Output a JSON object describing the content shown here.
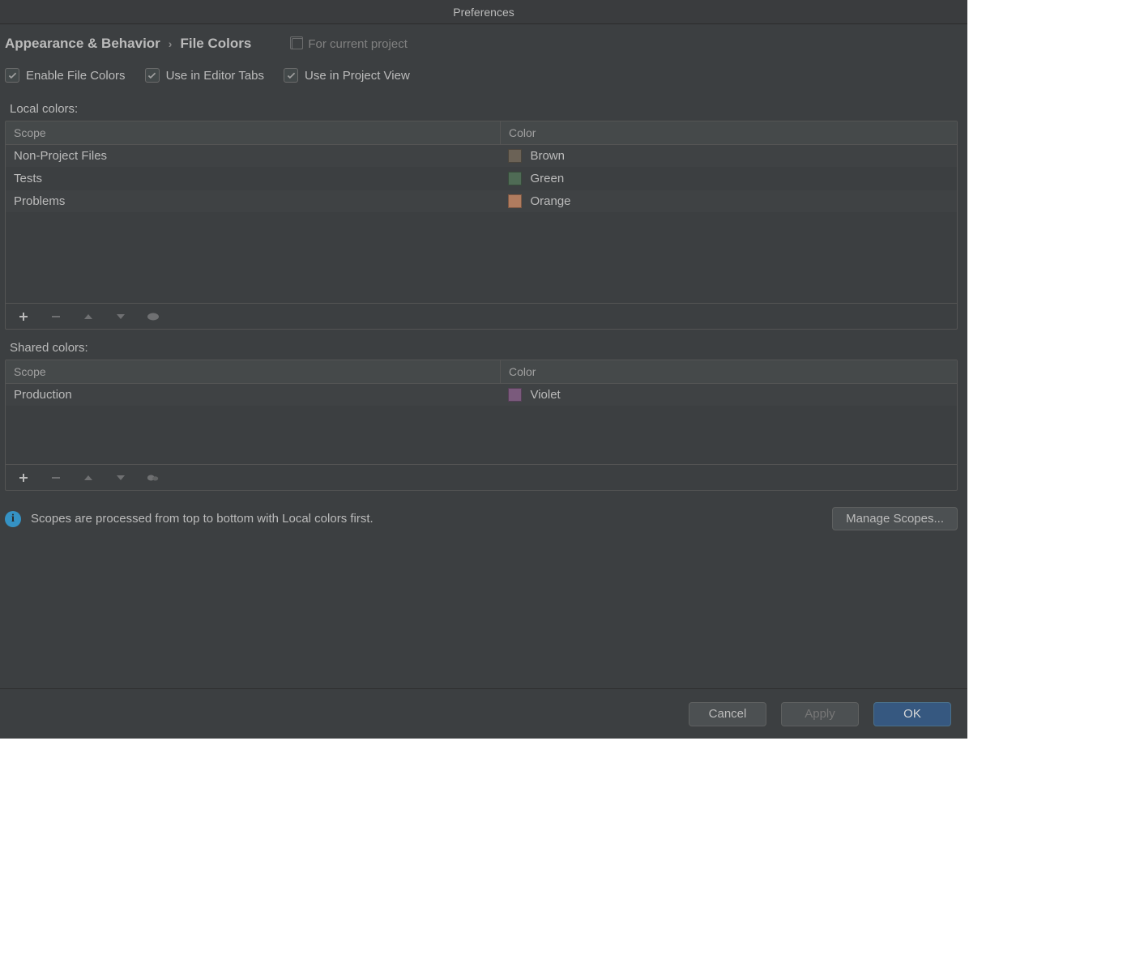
{
  "window": {
    "title": "Preferences"
  },
  "breadcrumb": {
    "parent": "Appearance & Behavior",
    "current": "File Colors"
  },
  "scope_indicator": "For current project",
  "checkboxes": {
    "enable": "Enable File Colors",
    "editor_tabs": "Use in Editor Tabs",
    "project_view": "Use in Project View"
  },
  "sections": {
    "local": {
      "label": "Local colors:",
      "columns": {
        "scope": "Scope",
        "color": "Color"
      },
      "rows": [
        {
          "scope": "Non-Project Files",
          "color_name": "Brown",
          "swatch": "#6b6256"
        },
        {
          "scope": "Tests",
          "color_name": "Green",
          "swatch": "#4f6b55"
        },
        {
          "scope": "Problems",
          "color_name": "Orange",
          "swatch": "#b07c5f"
        }
      ]
    },
    "shared": {
      "label": "Shared colors:",
      "columns": {
        "scope": "Scope",
        "color": "Color"
      },
      "rows": [
        {
          "scope": "Production",
          "color_name": "Violet",
          "swatch": "#7a5a7c"
        }
      ]
    }
  },
  "info": "Scopes are processed from top to bottom with Local colors first.",
  "buttons": {
    "manage_scopes": "Manage Scopes...",
    "cancel": "Cancel",
    "apply": "Apply",
    "ok": "OK"
  }
}
